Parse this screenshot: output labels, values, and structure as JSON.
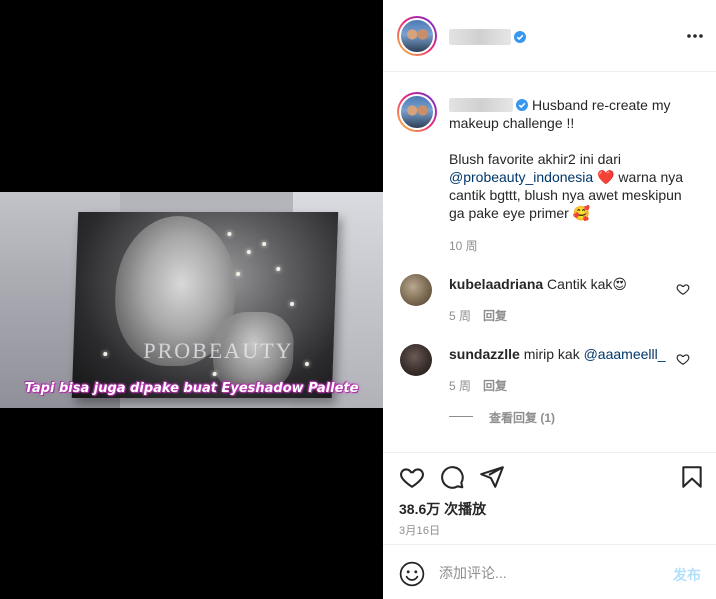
{
  "media": {
    "overlay_caption": "Tapi bisa juga dipake buat Eyeshadow Pallete",
    "brand_watermark": "PROBEAUTY"
  },
  "header": {
    "more_icon": "more-horizontal-icon"
  },
  "post": {
    "text_line1": "Husband re-create my makeup challenge !!",
    "text_intro": "Blush favorite akhir2 ini dari",
    "mention": "@probeauty_indonesia",
    "text_rest": " ❤️ warna nya cantik bgttt, blush nya awet meskipun ga pake eye primer 🥰",
    "time": "10 周"
  },
  "comments": [
    {
      "username": "kubelaadriana",
      "text": "Cantik kak😍",
      "time": "5 周",
      "reply_label": "回复"
    },
    {
      "username": "sundazzlle",
      "text": "mirip kak ",
      "mention": "@aaameelll_",
      "time": "5 周",
      "reply_label": "回复"
    }
  ],
  "view_replies": "查看回复 (1)",
  "actions": {
    "icons": [
      "heart-icon",
      "comment-icon",
      "share-icon",
      "bookmark-icon"
    ],
    "views": "38.6万 次播放",
    "date": "3月16日"
  },
  "comment_box": {
    "placeholder": "添加评论...",
    "post_label": "发布"
  },
  "colors": {
    "link": "#00376b",
    "muted": "#8e8e8e",
    "post_button_disabled": "#b2dffc",
    "verified": "#3897f0"
  }
}
